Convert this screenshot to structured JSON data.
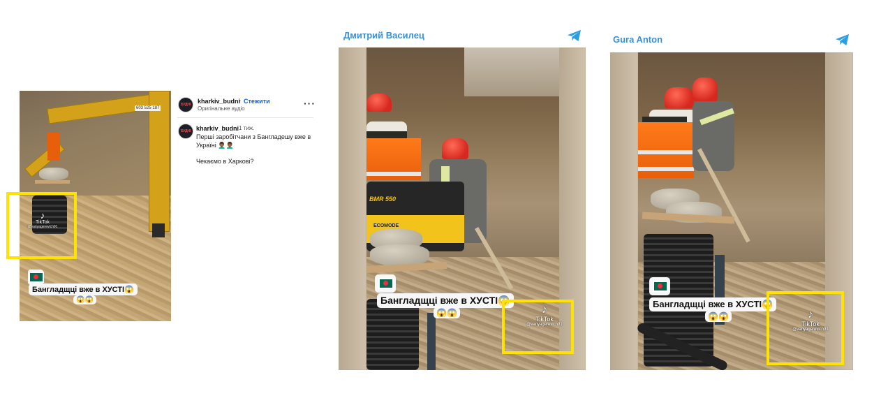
{
  "instagram": {
    "account": "kharkiv_budni",
    "avatar_text": "БУДНІ",
    "follow_label": "Стежити",
    "separator": "•",
    "audio_label": "Оригінальне аудіо",
    "more_icon": "more-horizontal-icon",
    "caption_account": "kharkiv_budni",
    "caption_time": "1 тиж.",
    "caption_text": "Перші заробітчани з Бангладешу вже в Україні 👨🏾‍🦱👨🏾‍🦱",
    "caption_text_2": "Чекаємо в Харкові?",
    "video": {
      "cab_label_1": "603 525 187",
      "tiktok_label": "TikTok",
      "tiktok_handle": "@vanyagerevich91",
      "overlay_caption": "Бангладщці вже в ХУСТІ😱",
      "overlay_emoji": "😱😱"
    }
  },
  "telegram_1": {
    "channel_name": "Дмитрий Василец",
    "icon": "telegram-icon",
    "video": {
      "machine_label": "BMR 550",
      "machine_sublabel": "ECOMODE",
      "overlay_caption": "Бангладщці вже в ХУСТІ😱",
      "overlay_emoji": "😱😱",
      "tiktok_label": "TikTok",
      "tiktok_handle": "@vanyagerevich91"
    }
  },
  "telegram_2": {
    "channel_name": "Gura Anton",
    "icon": "telegram-icon",
    "video": {
      "overlay_caption": "Бангладщці вже в ХУСТІ😱",
      "overlay_emoji": "😱😱",
      "tiktok_label": "TikTok",
      "tiktok_handle": "@vanyagerevich91"
    }
  },
  "colors": {
    "highlight": "#ffe300",
    "telegram_blue": "#3a8fd4",
    "instagram_follow": "#0a5fd6"
  }
}
